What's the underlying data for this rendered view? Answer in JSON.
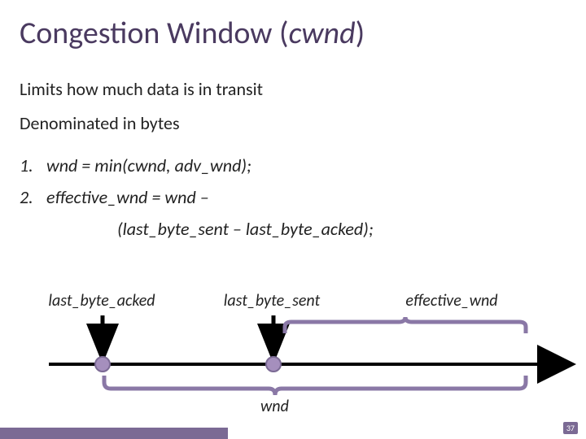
{
  "title": {
    "pre": "Congestion Window (",
    "cwnd": "cwnd",
    "post": ")"
  },
  "lines": {
    "l1": "Limits how much data is in transit",
    "l2": "Denominated in bytes"
  },
  "list": {
    "item1_num": "1.",
    "item1_body": "wnd = min(cwnd, adv_wnd);",
    "item2_num": "2.",
    "item2_body": "effective_wnd = wnd –",
    "item2_indent": "(last_byte_sent – last_byte_acked);"
  },
  "labels": {
    "acked": "last_byte_acked",
    "sent": "last_byte_sent",
    "eff": "effective_wnd",
    "wnd": "wnd"
  },
  "page": "37"
}
